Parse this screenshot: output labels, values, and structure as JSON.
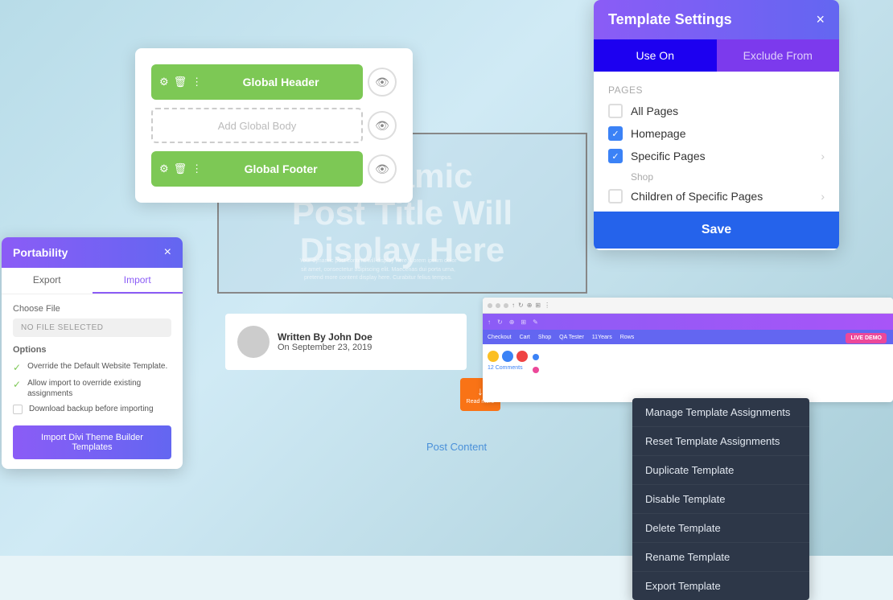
{
  "background": {
    "gradient": "linear-gradient(135deg, #b8dce8, #d0eaf5, #a8cdd8)"
  },
  "post_title": {
    "line1": "Dynamic",
    "line2": "Post Title Will",
    "line3": "Display Here"
  },
  "post_content_placeholder": "Your dynamic post content will display here. Lorem ipsum dolor sit amet, consectetur adipiscing elit. Maecenas dui porta urna, pretend more content display here. Curabitur felius tempus.",
  "written_by": {
    "prefix": "Written By",
    "name": "John Doe",
    "date": "On September 23, 2019"
  },
  "post_content_label": "Post Content",
  "builder_panel": {
    "header_label": "Global Header",
    "body_placeholder": "Add Global Body",
    "footer_label": "Global Footer"
  },
  "portability": {
    "title": "Portability",
    "close_icon": "×",
    "tabs": [
      {
        "label": "Export",
        "active": false
      },
      {
        "label": "Import",
        "active": true
      }
    ],
    "choose_file_label": "Choose File",
    "file_placeholder": "NO FILE SELECTED",
    "options_label": "Options",
    "options": [
      {
        "checked": true,
        "text": "Override the Default Website Template."
      },
      {
        "checked": true,
        "text": "Allow import to override existing assignments"
      },
      {
        "checked": false,
        "text": "Download backup before importing"
      }
    ],
    "import_button_label": "Import Divi Theme Builder Templates"
  },
  "template_settings": {
    "title": "Template Settings",
    "close_icon": "×",
    "tabs": [
      {
        "label": "Use On",
        "active": true
      },
      {
        "label": "Exclude From",
        "active": false
      }
    ],
    "pages_section_label": "Pages",
    "pages_options": [
      {
        "label": "All Pages",
        "checked": false
      },
      {
        "label": "Homepage",
        "checked": true
      },
      {
        "label": "Specific Pages",
        "checked": true,
        "has_chevron": true
      },
      {
        "sub_label": "Shop",
        "is_sub": true
      }
    ],
    "children_option": {
      "label": "Children of Specific Pages",
      "has_chevron": true
    },
    "save_button_label": "Save"
  },
  "context_menu": {
    "items": [
      {
        "label": "Manage Template Assignments"
      },
      {
        "label": "Reset Template Assignments"
      },
      {
        "label": "Duplicate Template"
      },
      {
        "label": "Disable Template"
      },
      {
        "label": "Delete Template"
      },
      {
        "label": "Rename Template"
      },
      {
        "label": "Export Template"
      }
    ]
  },
  "browser_nav_items": [
    "Checkout",
    "Cart",
    "Shop",
    "QA Tester",
    "11Years",
    "Rows"
  ],
  "live_demo_label": "LIVE DEMO",
  "comments_label": "12 Comments",
  "download_label": "Read more"
}
